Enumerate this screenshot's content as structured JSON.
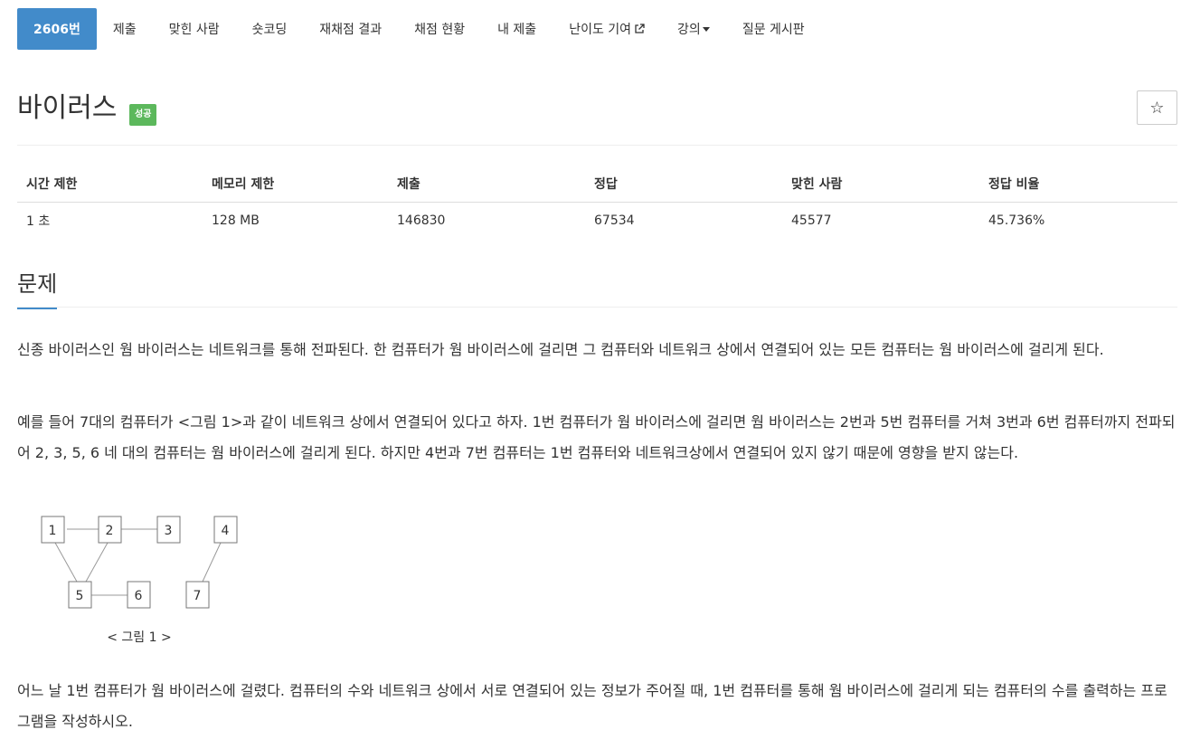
{
  "nav": {
    "tabs": [
      {
        "label": "2606번",
        "active": true
      },
      {
        "label": "제출"
      },
      {
        "label": "맞힌 사람"
      },
      {
        "label": "숏코딩"
      },
      {
        "label": "재채점 결과"
      },
      {
        "label": "채점 현황"
      },
      {
        "label": "내 제출"
      },
      {
        "label": "난이도 기여",
        "icon": "external-link-icon"
      },
      {
        "label": "강의",
        "icon": "caret-down-icon"
      },
      {
        "label": "질문 게시판"
      }
    ]
  },
  "problem": {
    "title": "바이러스",
    "status_badge": "성공",
    "star_icon": "☆"
  },
  "info": {
    "headers": [
      "시간 제한",
      "메모리 제한",
      "제출",
      "정답",
      "맞힌 사람",
      "정답 비율"
    ],
    "values": [
      "1 초",
      "128 MB",
      "146830",
      "67534",
      "45577",
      "45.736%"
    ]
  },
  "section": {
    "title": "문제",
    "paragraphs": [
      "신종 바이러스인 웜 바이러스는 네트워크를 통해 전파된다. 한 컴퓨터가 웜 바이러스에 걸리면 그 컴퓨터와 네트워크 상에서 연결되어 있는 모든 컴퓨터는 웜 바이러스에 걸리게 된다.",
      "예를 들어 7대의 컴퓨터가 <그림 1>과 같이 네트워크 상에서 연결되어 있다고 하자. 1번 컴퓨터가 웜 바이러스에 걸리면 웜 바이러스는 2번과 5번 컴퓨터를 거쳐 3번과 6번 컴퓨터까지 전파되어 2, 3, 5, 6 네 대의 컴퓨터는 웜 바이러스에 걸리게 된다. 하지만 4번과 7번 컴퓨터는 1번 컴퓨터와 네트워크상에서 연결되어 있지 않기 때문에 영향을 받지 않는다.",
      "어느 날 1번 컴퓨터가 웜 바이러스에 걸렸다. 컴퓨터의 수와 네트워크 상에서 서로 연결되어 있는 정보가 주어질 때, 1번 컴퓨터를 통해 웜 바이러스에 걸리게 되는 컴퓨터의 수를 출력하는 프로그램을 작성하시오."
    ]
  },
  "figure": {
    "nodes": [
      "1",
      "2",
      "3",
      "4",
      "5",
      "6",
      "7"
    ],
    "edges": [
      [
        "1",
        "2"
      ],
      [
        "2",
        "3"
      ],
      [
        "1",
        "5"
      ],
      [
        "2",
        "5"
      ],
      [
        "5",
        "6"
      ],
      [
        "4",
        "7"
      ]
    ],
    "caption": "< 그림 1 >"
  },
  "colors": {
    "accent": "#428bca",
    "success": "#5cb85c"
  }
}
